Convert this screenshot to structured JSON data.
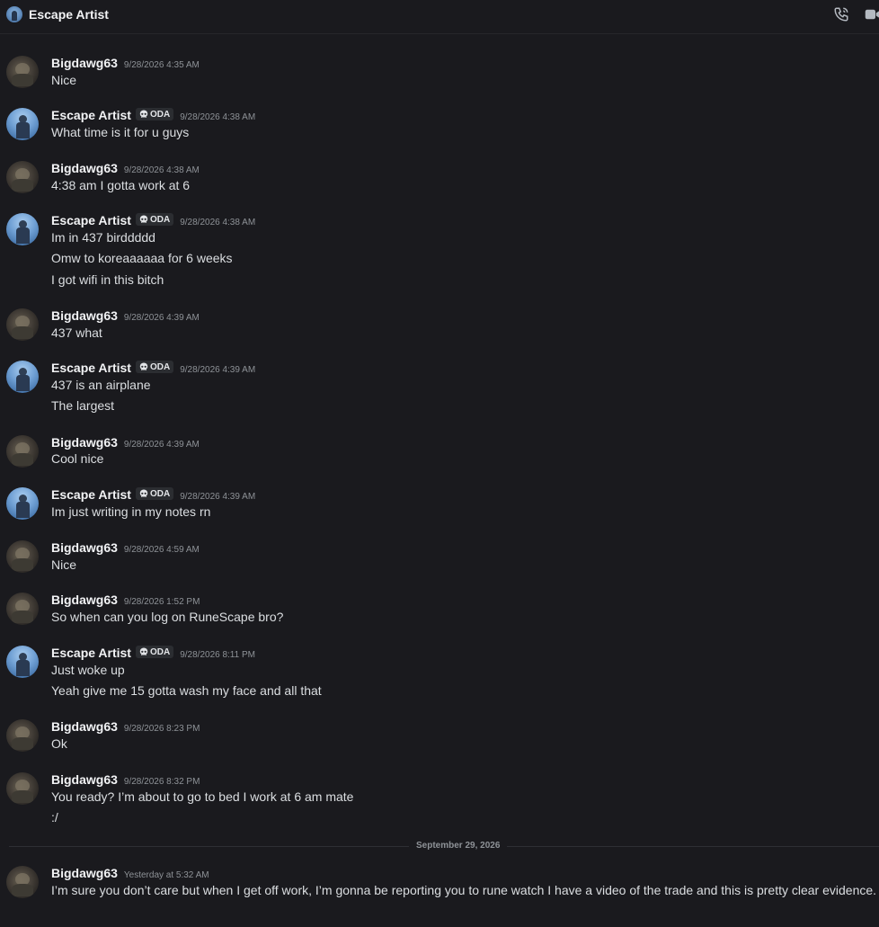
{
  "header": {
    "title": "Escape Artist",
    "call_icon": "phone-call-icon",
    "video_icon": "video-icon"
  },
  "tag_label": "ODA",
  "messages": [
    {
      "author": "Bigdawg63",
      "time": "9/28/2026 4:35 AM",
      "lines": [
        "Nice"
      ]
    },
    {
      "author": "Escape Artist",
      "time": "9/28/2026 4:38 AM",
      "lines": [
        "What time is it for u guys"
      ]
    },
    {
      "author": "Bigdawg63",
      "time": "9/28/2026 4:38 AM",
      "lines": [
        "4:38 am I gotta work at 6"
      ]
    },
    {
      "author": "Escape Artist",
      "time": "9/28/2026 4:38 AM",
      "lines": [
        "Im in 437 birddddd",
        "Omw to koreaaaaaa for 6 weeks",
        "I got wifi in this bitch"
      ]
    },
    {
      "author": "Bigdawg63",
      "time": "9/28/2026 4:39 AM",
      "lines": [
        "437 what"
      ]
    },
    {
      "author": "Escape Artist",
      "time": "9/28/2026 4:39 AM",
      "lines": [
        "437 is an airplane",
        "The largest"
      ]
    },
    {
      "author": "Bigdawg63",
      "time": "9/28/2026 4:39 AM",
      "lines": [
        "Cool nice"
      ]
    },
    {
      "author": "Escape Artist",
      "time": "9/28/2026 4:39 AM",
      "lines": [
        "Im just writing in my notes rn"
      ]
    },
    {
      "author": "Bigdawg63",
      "time": "9/28/2026 4:59 AM",
      "lines": [
        "Nice"
      ]
    },
    {
      "author": "Bigdawg63",
      "time": "9/28/2026 1:52 PM",
      "lines": [
        "So when can you log on RuneScape bro?"
      ]
    },
    {
      "author": "Escape Artist",
      "time": "9/28/2026 8:11 PM",
      "lines": [
        "Just woke up",
        "Yeah give me 15 gotta wash my face and all that"
      ]
    },
    {
      "author": "Bigdawg63",
      "time": "9/28/2026 8:23 PM",
      "lines": [
        "Ok"
      ]
    },
    {
      "author": "Bigdawg63",
      "time": "9/28/2026 8:32 PM",
      "lines": [
        "You ready? I’m about to go to bed I work at 6 am mate",
        ":/"
      ]
    },
    {
      "author": "Bigdawg63",
      "time": "Yesterday at 5:32 AM",
      "lines": [
        "I’m sure you don’t care but when I get off work, I’m gonna be reporting you to rune watch I have a video of the trade and this is pretty clear evidence."
      ]
    }
  ],
  "date_divider": "September 29, 2026"
}
